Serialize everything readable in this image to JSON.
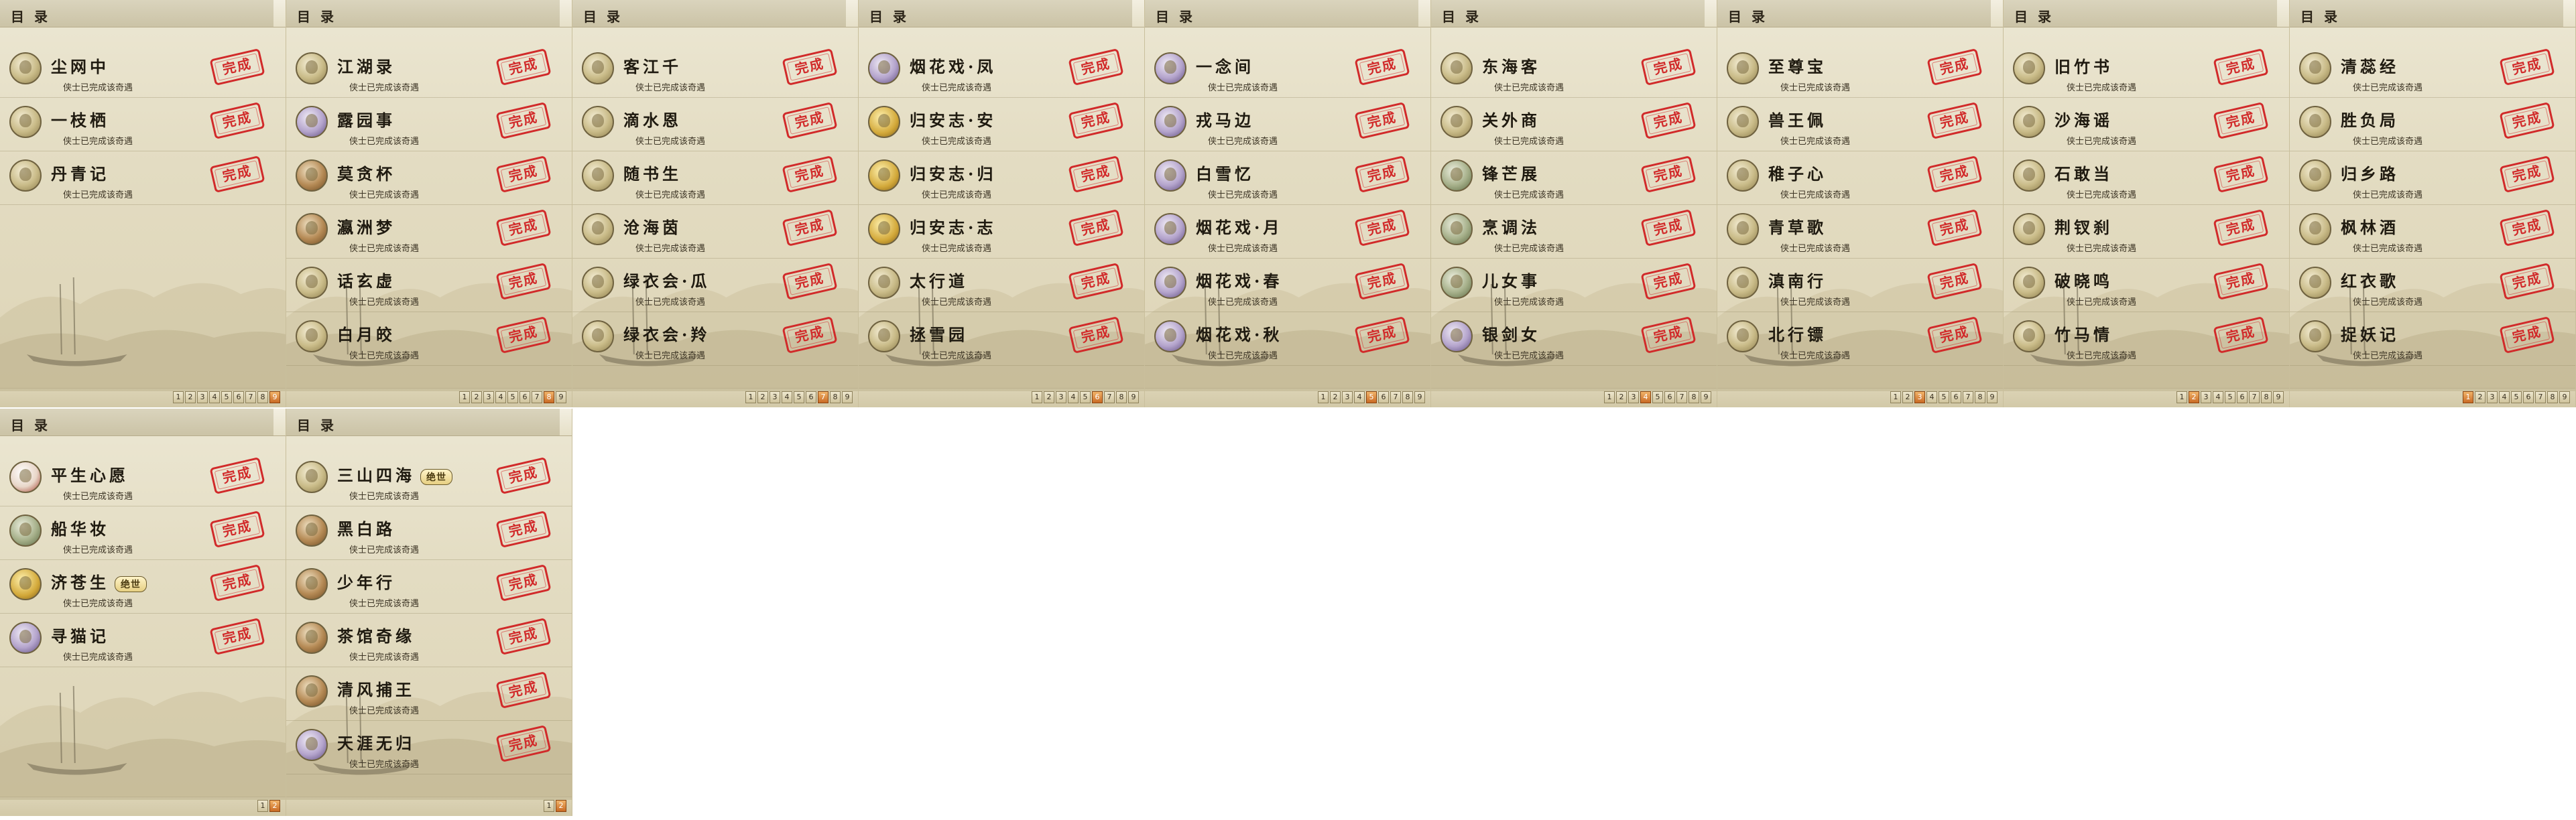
{
  "header_title": "目 录",
  "desc": "侠士已完成该奇遇",
  "stamp_label": "完成",
  "panels": [
    {
      "rows": [
        {
          "name": "尘网中",
          "av": ""
        },
        {
          "name": "一枝栖",
          "av": ""
        },
        {
          "name": "丹青记",
          "av": ""
        }
      ],
      "pages": [
        "1",
        "2",
        "3",
        "4",
        "5",
        "6",
        "7",
        "8",
        "9"
      ],
      "cur": 8
    },
    {
      "rows": [
        {
          "name": "江湖录",
          "av": ""
        },
        {
          "name": "露园事",
          "av": "violet"
        },
        {
          "name": "莫贪杯",
          "av": "beast"
        },
        {
          "name": "瀛洲梦",
          "av": "beast"
        },
        {
          "name": "话玄虚",
          "av": ""
        },
        {
          "name": "白月皎",
          "av": ""
        }
      ],
      "pages": [
        "1",
        "2",
        "3",
        "4",
        "5",
        "6",
        "7",
        "8",
        "9"
      ],
      "cur": 7
    },
    {
      "rows": [
        {
          "name": "客江千",
          "av": ""
        },
        {
          "name": "滴水恩",
          "av": ""
        },
        {
          "name": "随书生",
          "av": ""
        },
        {
          "name": "沧海茵",
          "av": ""
        },
        {
          "name": "绿衣会·瓜",
          "av": ""
        },
        {
          "name": "绿衣会·羚",
          "av": ""
        }
      ],
      "pages": [
        "1",
        "2",
        "3",
        "4",
        "5",
        "6",
        "7",
        "8",
        "9"
      ],
      "cur": 6
    },
    {
      "rows": [
        {
          "name": "烟花戏·凤",
          "av": "violet"
        },
        {
          "name": "归安志·安",
          "av": "gold"
        },
        {
          "name": "归安志·归",
          "av": "gold"
        },
        {
          "name": "归安志·志",
          "av": "gold"
        },
        {
          "name": "太行道",
          "av": ""
        },
        {
          "name": "拯雪园",
          "av": ""
        }
      ],
      "pages": [
        "1",
        "2",
        "3",
        "4",
        "5",
        "6",
        "7",
        "8",
        "9"
      ],
      "cur": 5
    },
    {
      "rows": [
        {
          "name": "一念间",
          "av": "violet"
        },
        {
          "name": "戎马边",
          "av": "violet"
        },
        {
          "name": "白雪忆",
          "av": "violet"
        },
        {
          "name": "烟花戏·月",
          "av": "violet"
        },
        {
          "name": "烟花戏·春",
          "av": "violet"
        },
        {
          "name": "烟花戏·秋",
          "av": "violet"
        }
      ],
      "pages": [
        "1",
        "2",
        "3",
        "4",
        "5",
        "6",
        "7",
        "8",
        "9"
      ],
      "cur": 4
    },
    {
      "rows": [
        {
          "name": "东海客",
          "av": ""
        },
        {
          "name": "关外商",
          "av": ""
        },
        {
          "name": "锋芒展",
          "av": "green"
        },
        {
          "name": "烹调法",
          "av": "green"
        },
        {
          "name": "儿女事",
          "av": "green"
        },
        {
          "name": "银剑女",
          "av": "violet"
        }
      ],
      "pages": [
        "1",
        "2",
        "3",
        "4",
        "5",
        "6",
        "7",
        "8",
        "9"
      ],
      "cur": 3
    },
    {
      "rows": [
        {
          "name": "至尊宝",
          "av": ""
        },
        {
          "name": "兽王佩",
          "av": ""
        },
        {
          "name": "稚子心",
          "av": ""
        },
        {
          "name": "青草歌",
          "av": ""
        },
        {
          "name": "滇南行",
          "av": ""
        },
        {
          "name": "北行镖",
          "av": ""
        }
      ],
      "pages": [
        "1",
        "2",
        "3",
        "4",
        "5",
        "6",
        "7",
        "8",
        "9"
      ],
      "cur": 2
    },
    {
      "rows": [
        {
          "name": "旧竹书",
          "av": ""
        },
        {
          "name": "沙海谣",
          "av": ""
        },
        {
          "name": "石敢当",
          "av": ""
        },
        {
          "name": "荆钗刹",
          "av": ""
        },
        {
          "name": "破晓鸣",
          "av": ""
        },
        {
          "name": "竹马情",
          "av": ""
        }
      ],
      "pages": [
        "1",
        "2",
        "3",
        "4",
        "5",
        "6",
        "7",
        "8",
        "9"
      ],
      "cur": 1
    },
    {
      "rows": [
        {
          "name": "清蕊经",
          "av": ""
        },
        {
          "name": "胜负局",
          "av": ""
        },
        {
          "name": "归乡路",
          "av": ""
        },
        {
          "name": "枫林酒",
          "av": ""
        },
        {
          "name": "红衣歌",
          "av": ""
        },
        {
          "name": "捉妖记",
          "av": ""
        }
      ],
      "pages": [
        "1",
        "2",
        "3",
        "4",
        "5",
        "6",
        "7",
        "8",
        "9"
      ],
      "cur": 0
    },
    {
      "rows": [
        {
          "name": "平生心愿",
          "av": "red"
        },
        {
          "name": "船华妆",
          "av": "green"
        },
        {
          "name": "济苍生",
          "av": "gold",
          "badge": "绝世"
        },
        {
          "name": "寻猫记",
          "av": "violet"
        }
      ],
      "pages": [
        "1",
        "2"
      ],
      "cur": 1
    },
    {
      "rows": [
        {
          "name": "三山四海",
          "av": "",
          "badge": "绝世"
        },
        {
          "name": "黑白路",
          "av": "beast"
        },
        {
          "name": "少年行",
          "av": "beast"
        },
        {
          "name": "茶馆奇缘",
          "av": "beast"
        },
        {
          "name": "清风捕王",
          "av": "beast"
        },
        {
          "name": "天涯无归",
          "av": "violet"
        }
      ],
      "pages": [
        "1",
        "2"
      ],
      "cur": 1
    }
  ]
}
